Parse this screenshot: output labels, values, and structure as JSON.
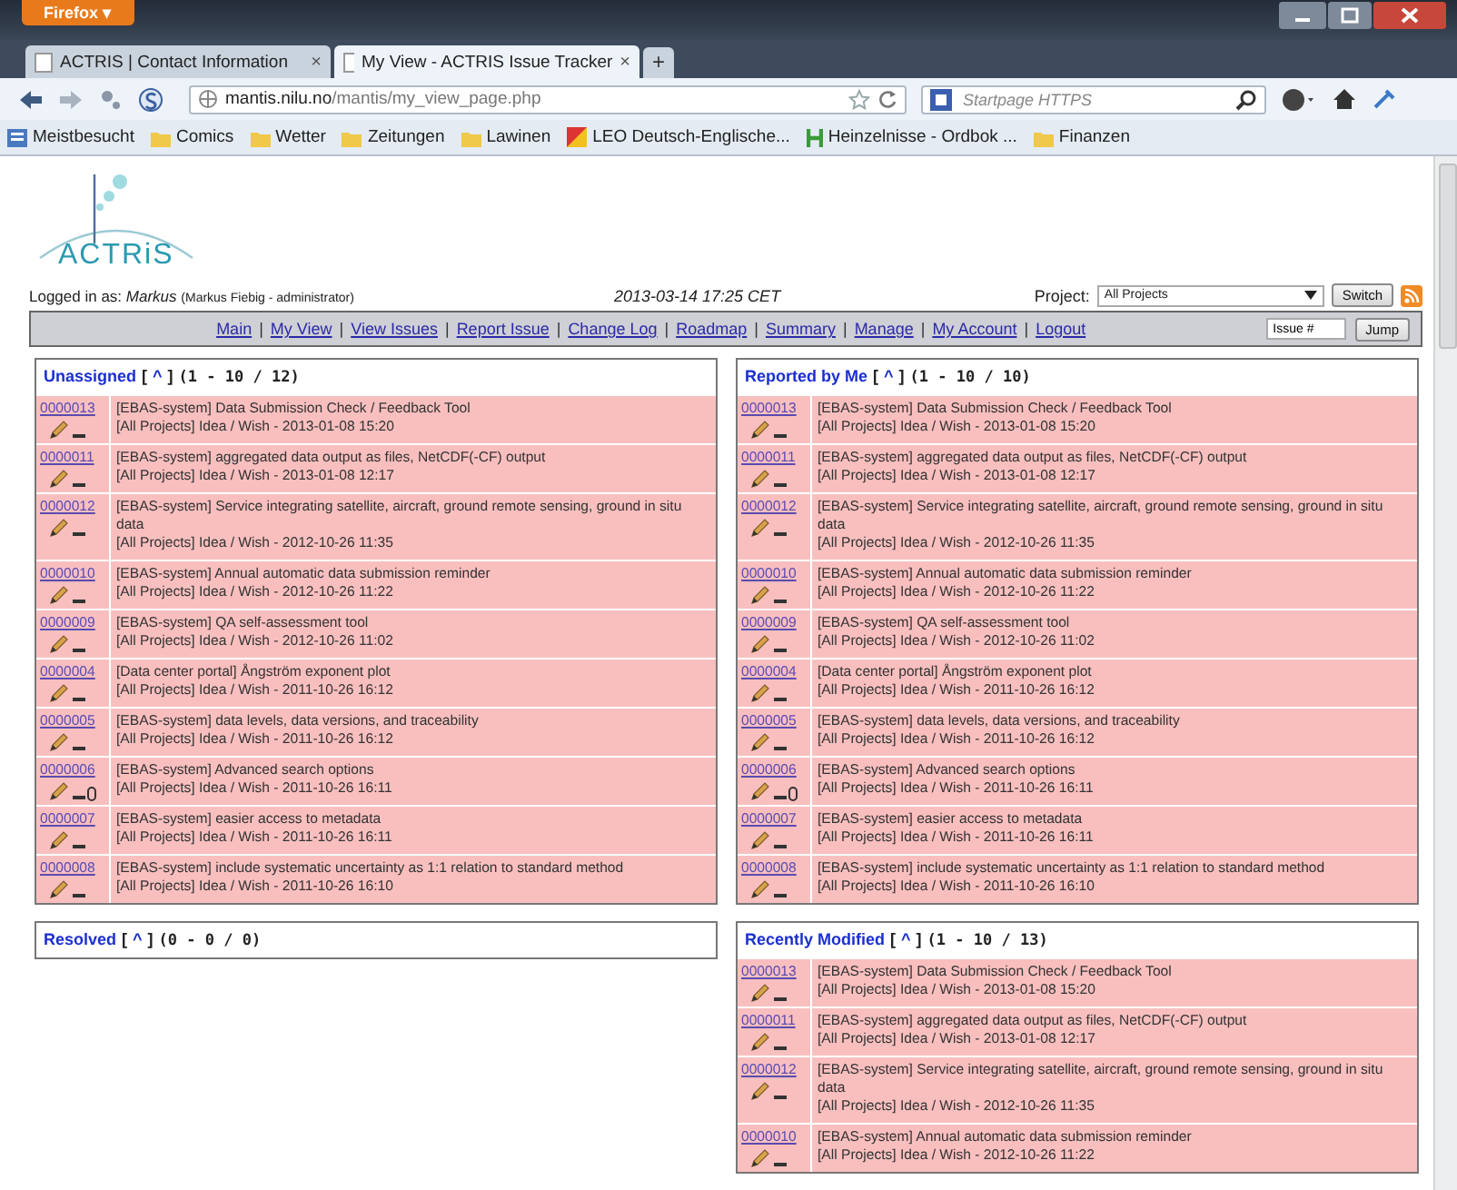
{
  "browser": {
    "menu_button": "Firefox ▾",
    "tabs": [
      {
        "title": "ACTRIS | Contact Information",
        "close": "×",
        "selected": false
      },
      {
        "title": "My View - ACTRIS Issue Tracker",
        "close": "×",
        "selected": true
      }
    ],
    "new_tab": "+",
    "url_host": "mantis.nilu.no",
    "url_path": "/mantis/my_view_page.php",
    "search_placeholder": "Startpage HTTPS",
    "bookmarks": [
      {
        "label": "Meistbesucht",
        "kind": "page"
      },
      {
        "label": "Comics",
        "kind": "folder"
      },
      {
        "label": "Wetter",
        "kind": "folder"
      },
      {
        "label": "Zeitungen",
        "kind": "folder"
      },
      {
        "label": "Lawinen",
        "kind": "folder"
      },
      {
        "label": "LEO Deutsch-Englische...",
        "kind": "leo"
      },
      {
        "label": "Heinzelnisse - Ordbok ...",
        "kind": "h"
      },
      {
        "label": "Finanzen",
        "kind": "folder"
      }
    ]
  },
  "page": {
    "logo": "ACTRiS",
    "logged_in": {
      "label": "Logged in as:",
      "user": "Markus",
      "detail": "(Markus Fiebig - administrator)"
    },
    "datetime": "2013-03-14 17:25 CET",
    "project": {
      "label": "Project:",
      "value": "All Projects",
      "button": "Switch"
    },
    "menu": [
      {
        "label": "Main"
      },
      {
        "sep": "|",
        "label": "My View"
      },
      {
        "sep": "|",
        "label": "View Issues"
      },
      {
        "sep": "|",
        "label": "Report Issue"
      },
      {
        "sep": "|",
        "label": "Change Log"
      },
      {
        "sep": "|",
        "label": "Roadmap"
      },
      {
        "sep": "|",
        "label": "Summary"
      },
      {
        "sep": "|",
        "label": "Manage"
      },
      {
        "sep": "|",
        "label": "My Account"
      },
      {
        "sep": "|",
        "label": "Logout"
      }
    ],
    "jump": {
      "value": "Issue #",
      "button": "Jump"
    },
    "columns": [
      {
        "panels": [
          {
            "title": "Unassigned",
            "open": "[",
            "pager": "^",
            "close": "]",
            "range": "(1 - 10 / 12)",
            "issues": [
              {
                "id": "0000013",
                "summary": "[EBAS-system] Data Submission Check / Feedback Tool",
                "meta": "[All Projects] Idea / Wish - 2013-01-08 15:20",
                "attachment": false
              },
              {
                "id": "0000011",
                "summary": "[EBAS-system] aggregated data output as files, NetCDF(-CF) output",
                "meta": "[All Projects] Idea / Wish - 2013-01-08 12:17",
                "attachment": false
              },
              {
                "id": "0000012",
                "summary": "[EBAS-system] Service integrating satellite, aircraft, ground remote sensing, ground in situ data",
                "meta": "[All Projects] Idea / Wish - 2012-10-26 11:35",
                "attachment": false
              },
              {
                "id": "0000010",
                "summary": "[EBAS-system] Annual automatic data submission reminder",
                "meta": "[All Projects] Idea / Wish - 2012-10-26 11:22",
                "attachment": false
              },
              {
                "id": "0000009",
                "summary": "[EBAS-system] QA self-assessment tool",
                "meta": "[All Projects] Idea / Wish - 2012-10-26 11:02",
                "attachment": false
              },
              {
                "id": "0000004",
                "summary": "[Data center portal] Ångström exponent plot",
                "meta": "[All Projects] Idea / Wish - 2011-10-26 16:12",
                "attachment": false
              },
              {
                "id": "0000005",
                "summary": "[EBAS-system] data levels, data versions, and traceability",
                "meta": "[All Projects] Idea / Wish - 2011-10-26 16:12",
                "attachment": false
              },
              {
                "id": "0000006",
                "summary": "[EBAS-system] Advanced search options",
                "meta": "[All Projects] Idea / Wish - 2011-10-26 16:11",
                "attachment": true
              },
              {
                "id": "0000007",
                "summary": "[EBAS-system] easier access to metadata",
                "meta": "[All Projects] Idea / Wish - 2011-10-26 16:11",
                "attachment": false
              },
              {
                "id": "0000008",
                "summary": "[EBAS-system] include systematic uncertainty as 1:1 relation to standard method",
                "meta": "[All Projects] Idea / Wish - 2011-10-26 16:10",
                "attachment": false
              }
            ]
          },
          {
            "title": "Resolved",
            "open": "[",
            "pager": "^",
            "close": "]",
            "range": "(0 - 0 / 0)"
          }
        ]
      },
      {
        "panels": [
          {
            "title": "Reported by Me",
            "open": "[",
            "pager": "^",
            "close": "]",
            "range": "(1 - 10 / 10)",
            "issues": [
              {
                "id": "0000013",
                "summary": "[EBAS-system] Data Submission Check / Feedback Tool",
                "meta": "[All Projects] Idea / Wish - 2013-01-08 15:20",
                "attachment": false
              },
              {
                "id": "0000011",
                "summary": "[EBAS-system] aggregated data output as files, NetCDF(-CF) output",
                "meta": "[All Projects] Idea / Wish - 2013-01-08 12:17",
                "attachment": false
              },
              {
                "id": "0000012",
                "summary": "[EBAS-system] Service integrating satellite, aircraft, ground remote sensing, ground in situ data",
                "meta": "[All Projects] Idea / Wish - 2012-10-26 11:35",
                "attachment": false
              },
              {
                "id": "0000010",
                "summary": "[EBAS-system] Annual automatic data submission reminder",
                "meta": "[All Projects] Idea / Wish - 2012-10-26 11:22",
                "attachment": false
              },
              {
                "id": "0000009",
                "summary": "[EBAS-system] QA self-assessment tool",
                "meta": "[All Projects] Idea / Wish - 2012-10-26 11:02",
                "attachment": false
              },
              {
                "id": "0000004",
                "summary": "[Data center portal] Ångström exponent plot",
                "meta": "[All Projects] Idea / Wish - 2011-10-26 16:12",
                "attachment": false
              },
              {
                "id": "0000005",
                "summary": "[EBAS-system] data levels, data versions, and traceability",
                "meta": "[All Projects] Idea / Wish - 2011-10-26 16:12",
                "attachment": false
              },
              {
                "id": "0000006",
                "summary": "[EBAS-system] Advanced search options",
                "meta": "[All Projects] Idea / Wish - 2011-10-26 16:11",
                "attachment": true
              },
              {
                "id": "0000007",
                "summary": "[EBAS-system] easier access to metadata",
                "meta": "[All Projects] Idea / Wish - 2011-10-26 16:11",
                "attachment": false
              },
              {
                "id": "0000008",
                "summary": "[EBAS-system] include systematic uncertainty as 1:1 relation to standard method",
                "meta": "[All Projects] Idea / Wish - 2011-10-26 16:10",
                "attachment": false
              }
            ]
          },
          {
            "title": "Recently Modified",
            "open": "[",
            "pager": "^",
            "close": "]",
            "range": "(1 - 10 / 13)",
            "issues": [
              {
                "id": "0000013",
                "summary": "[EBAS-system] Data Submission Check / Feedback Tool",
                "meta": "[All Projects] Idea / Wish - 2013-01-08 15:20",
                "attachment": false
              },
              {
                "id": "0000011",
                "summary": "[EBAS-system] aggregated data output as files, NetCDF(-CF) output",
                "meta": "[All Projects] Idea / Wish - 2013-01-08 12:17",
                "attachment": false
              },
              {
                "id": "0000012",
                "summary": "[EBAS-system] Service integrating satellite, aircraft, ground remote sensing, ground in situ data",
                "meta": "[All Projects] Idea / Wish - 2012-10-26 11:35",
                "attachment": false
              },
              {
                "id": "0000010",
                "summary": "[EBAS-system] Annual automatic data submission reminder",
                "meta": "[All Projects] Idea / Wish - 2012-10-26 11:22",
                "attachment": false
              }
            ]
          }
        ]
      }
    ]
  }
}
